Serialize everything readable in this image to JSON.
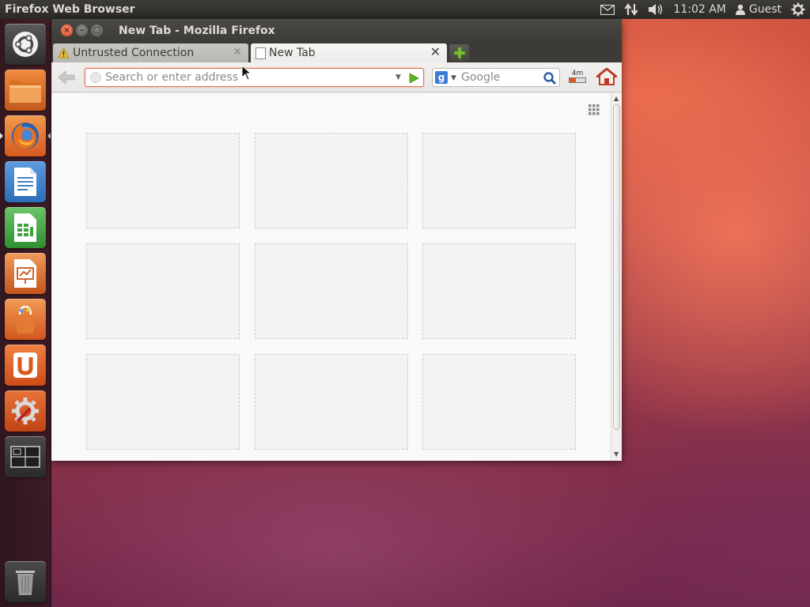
{
  "top_panel": {
    "app_title": "Firefox Web Browser",
    "time": "11:02 AM",
    "user": "Guest"
  },
  "launcher": {
    "items": [
      {
        "name": "Dash home",
        "icon": "ubuntu-logo-icon",
        "color": "#3a3a3a"
      },
      {
        "name": "Files",
        "icon": "folder-icon",
        "color": "#e2742e"
      },
      {
        "name": "Firefox Web Browser",
        "icon": "firefox-icon",
        "color": "#e86a2c",
        "running": true
      },
      {
        "name": "LibreOffice Writer",
        "icon": "writer-icon",
        "color": "#2a6fb8"
      },
      {
        "name": "LibreOffice Calc",
        "icon": "calc-icon",
        "color": "#3aa33a"
      },
      {
        "name": "LibreOffice Impress",
        "icon": "impress-icon",
        "color": "#d66a2a"
      },
      {
        "name": "Ubuntu Software Center",
        "icon": "software-center-icon",
        "color": "#e0662a"
      },
      {
        "name": "Ubuntu One",
        "icon": "ubuntu-one-icon",
        "color": "#e05a20"
      },
      {
        "name": "System Settings",
        "icon": "settings-icon",
        "color": "#d9582a"
      },
      {
        "name": "Workspace Switcher",
        "icon": "workspace-icon",
        "color": "#3a3a3a"
      },
      {
        "name": "Trash",
        "icon": "trash-icon",
        "color": "#3a3a3a"
      }
    ]
  },
  "window": {
    "title": "New Tab - Mozilla Firefox",
    "tabs": [
      {
        "label": "Untrusted Connection",
        "icon": "warning-icon",
        "active": false
      },
      {
        "label": "New Tab",
        "icon": "blank-page-icon",
        "active": true
      }
    ]
  },
  "navbar": {
    "url_placeholder": "Search or enter address",
    "url_value": "",
    "search_placeholder": "Google",
    "search_engine_letter": "g",
    "download_label": "4m"
  },
  "colors": {
    "accent": "#dd4814",
    "panel": "#3c3b37",
    "urlbar_focus": "#e07050"
  }
}
